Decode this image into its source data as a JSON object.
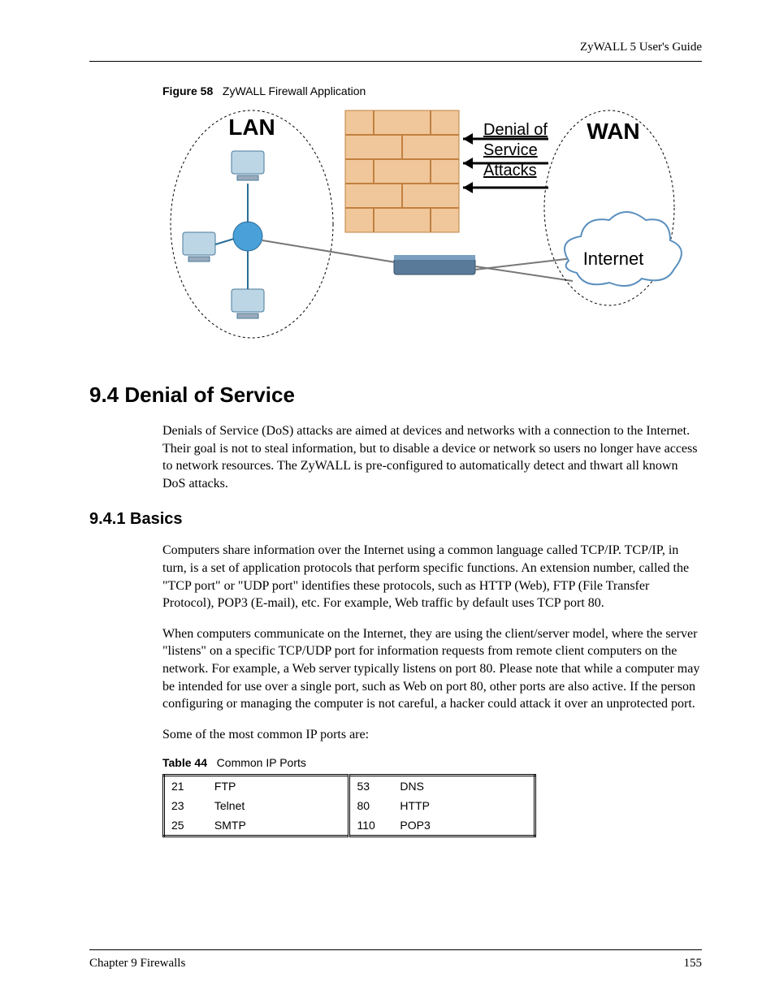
{
  "header": {
    "guide": "ZyWALL 5 User's Guide"
  },
  "figure": {
    "label": "Figure 58",
    "title": "ZyWALL Firewall Application",
    "lan": "LAN",
    "wan": "WAN",
    "dos1": "Denial of",
    "dos2": "Service",
    "dos3": "Attacks",
    "internet": "Internet"
  },
  "section": {
    "num_title": "9.4  Denial of Service",
    "para1": "Denials of Service (DoS) attacks are aimed at devices and networks with a connection to the Internet. Their goal is not to steal information, but to disable a device or network so users no longer have access to network resources. The ZyWALL is pre-configured to automatically detect and thwart all known DoS attacks."
  },
  "subsection": {
    "num_title": "9.4.1  Basics",
    "para1": "Computers share information over the Internet using a common language called TCP/IP. TCP/IP, in turn, is a set of application protocols that perform specific functions. An extension number, called the \"TCP port\" or \"UDP port\" identifies these protocols, such as HTTP (Web), FTP (File Transfer Protocol), POP3 (E-mail), etc. For example, Web traffic by default uses TCP port 80.",
    "para2": "When computers communicate on the Internet, they are using the client/server model, where the server \"listens\" on a specific TCP/UDP port for information requests from remote client computers on the network. For example, a Web server typically listens on port 80. Please note that while a computer may be intended for use over a single port, such as Web on port 80, other ports are also active. If the person configuring or managing the computer is not careful, a hacker could attack it over an unprotected port.",
    "para3": "Some of the most common IP ports are:"
  },
  "table": {
    "label": "Table 44",
    "title": "Common IP Ports",
    "rows": [
      {
        "p1": "21",
        "s1": "FTP",
        "p2": "53",
        "s2": "DNS"
      },
      {
        "p1": "23",
        "s1": "Telnet",
        "p2": "80",
        "s2": "HTTP"
      },
      {
        "p1": "25",
        "s1": "SMTP",
        "p2": "110",
        "s2": "POP3"
      }
    ]
  },
  "footer": {
    "chapter": "Chapter 9 Firewalls",
    "page": "155"
  }
}
